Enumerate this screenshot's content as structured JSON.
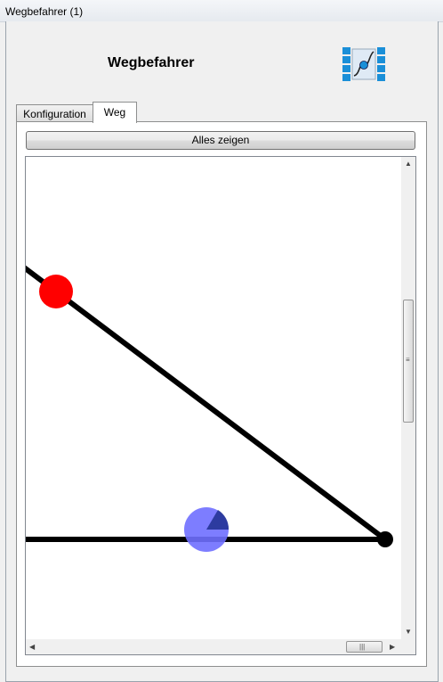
{
  "window": {
    "title": "Wegbefahrer (1)"
  },
  "header": {
    "title": "Wegbefahrer",
    "logo_icon": "path-runner-logo-icon"
  },
  "tabs": [
    {
      "label": "Konfiguration",
      "active": false
    },
    {
      "label": "Weg",
      "active": true
    }
  ],
  "toolbar": {
    "show_all_label": "Alles zeigen"
  },
  "colors": {
    "path_line": "#000000",
    "waypoint_red": "#ff0000",
    "vehicle_blue": "#6f6fff",
    "vehicle_heading": "#1f2f8f",
    "logo_blue": "#1a8fd8"
  },
  "scrollbars": {
    "vertical_icon": "scroll-vertical-grip-icon",
    "horizontal_icon": "scroll-horizontal-grip-icon"
  }
}
